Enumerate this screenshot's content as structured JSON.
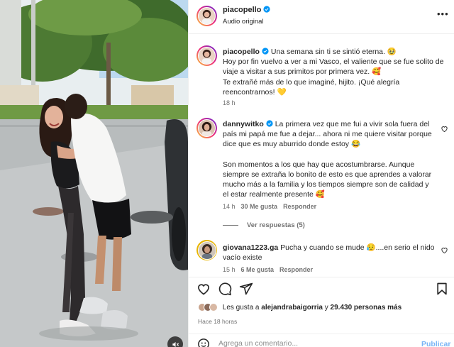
{
  "post": {
    "author": "piacopello",
    "audio": "Audio original",
    "caption_lines": [
      "Una semana sin ti se sintió eterna. 🥹",
      "Hoy por fin vuelvo a ver a mi Vasco, el valiente que se fue solito de",
      "viaje a visitar a sus primitos por primera vez. 🥰",
      "Te extrañé más de lo que imaginé, hijito. ¡Qué alegría",
      "reencontrarnos! 💛"
    ],
    "caption_time": "18 h"
  },
  "comments": [
    {
      "user": "dannywitko",
      "lines": [
        "La primera vez que me fui a vivir sola fuera del",
        "país mi papá me fue a dejar... ahora ni me quiere visitar porque",
        "dice que es muy aburrido donde estoy 😂",
        "",
        "Son momentos a los que hay que acostumbrarse. Aunque",
        "siempre se extraña lo bonito de esto es que aprendes a valorar",
        "mucho más a la familia y los tiempos siempre son de calidad y",
        "el estar realmente presente 🥰"
      ],
      "time": "14 h",
      "likes": "30 Me gusta",
      "reply": "Responder",
      "view_replies": "Ver respuestas (5)"
    },
    {
      "user": "giovana1223.ga",
      "lines": [
        "Pucha y cuando se mude 😥....en serio el nido",
        "vacío existe"
      ],
      "time": "15 h",
      "likes": "6 Me gusta",
      "reply": "Responder"
    }
  ],
  "likes": {
    "prefix": "Les gusta a",
    "user": "alejandrabaigorria",
    "joiner": "y",
    "others": "29.430 personas más"
  },
  "time_ago": "Hace 18 horas",
  "add_comment": {
    "placeholder": "Agrega un comentario...",
    "publish": "Publicar"
  },
  "colors": {
    "verified": "#0095f6",
    "like_heart": "#ed4956",
    "publish_disabled": "#7ab5f5"
  },
  "icons": [
    "heart-icon",
    "comment-icon",
    "share-icon",
    "bookmark-icon",
    "emoji-icon",
    "more-icon",
    "verified-icon",
    "sound-icon"
  ]
}
